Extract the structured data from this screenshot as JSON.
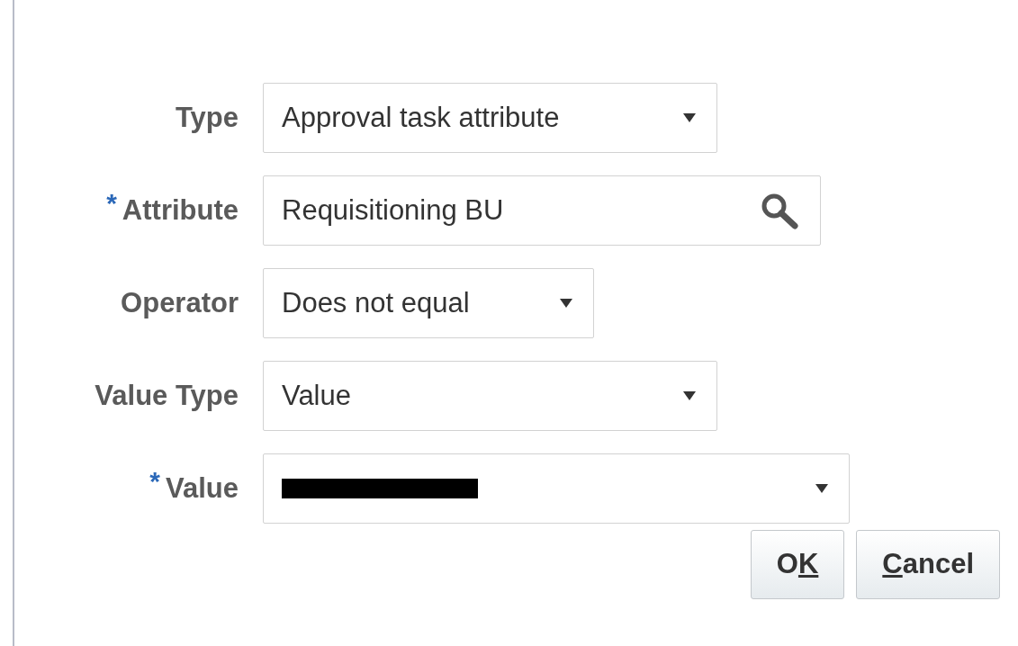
{
  "fields": [
    {
      "label": "Type",
      "kind": "select",
      "value": "Approval task attribute",
      "redacted": false
    },
    {
      "label": "Attribute",
      "required_mark": "*",
      "kind": "lookup",
      "value": "Requisitioning BU",
      "redacted": false
    },
    {
      "label": "Operator",
      "kind": "select",
      "value": "Does not equal",
      "redacted": false
    },
    {
      "label": "Value Type",
      "kind": "select",
      "value": "Value",
      "redacted": false
    },
    {
      "label": "Value",
      "required_mark": "*",
      "kind": "select",
      "redacted": true
    }
  ],
  "buttons": [
    {
      "parts": [
        {
          "text": "O",
          "underlined": false
        },
        {
          "text": "K",
          "underlined": true
        }
      ]
    },
    {
      "parts": [
        {
          "text": "C",
          "underlined": true
        },
        {
          "text": "ancel",
          "underlined": false
        }
      ]
    }
  ]
}
